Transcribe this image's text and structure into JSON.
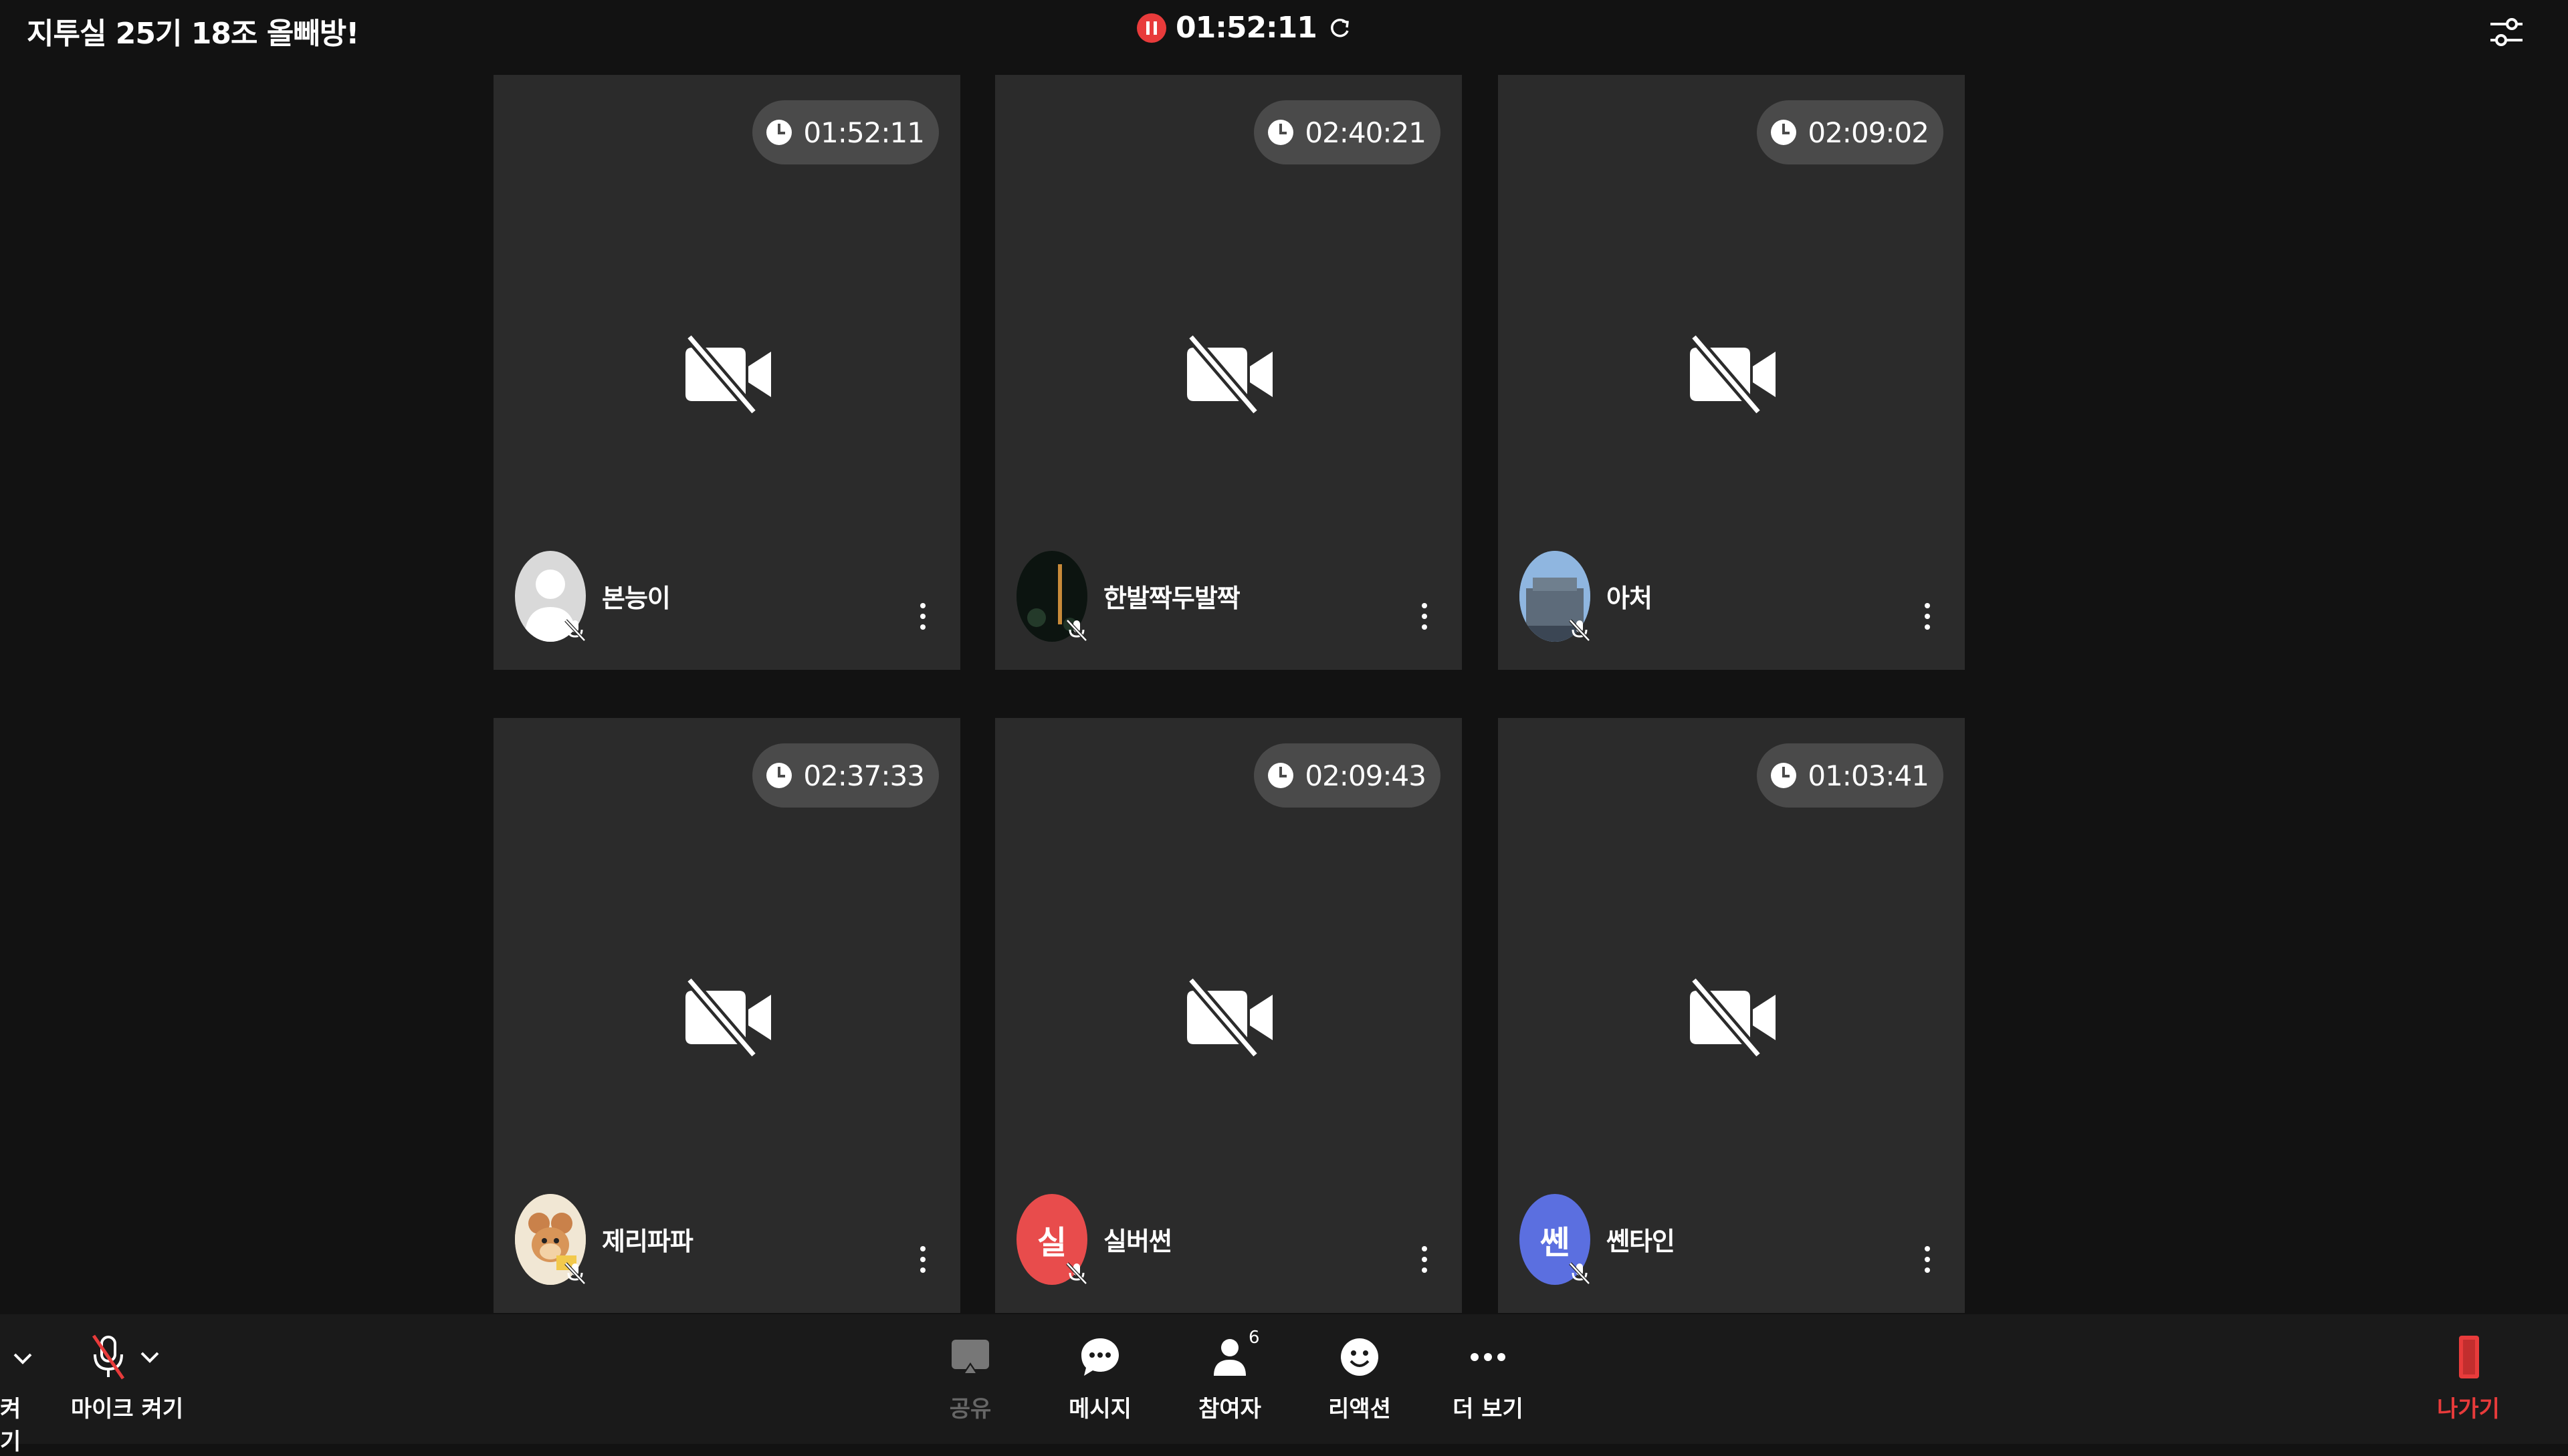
{
  "header": {
    "room_title": "지투실 25기 18조 올빼방!",
    "session_timer": "01:52:11",
    "colors": {
      "record": "#e83b3b",
      "tile_bg": "#2b2b2b",
      "pill_bg": "#4a4a4a"
    }
  },
  "participants": [
    {
      "name": "본능이",
      "timer": "01:52:11",
      "avatar_type": "default-person",
      "avatar_letter": "",
      "avatar_color": "#d9d9d9"
    },
    {
      "name": "한발짝두발짝",
      "timer": "02:40:21",
      "avatar_type": "night-photo",
      "avatar_letter": "",
      "avatar_color": "#1b2a20"
    },
    {
      "name": "아처",
      "timer": "02:09:02",
      "avatar_type": "building-photo",
      "avatar_letter": "",
      "avatar_color": "#7aa0c8"
    },
    {
      "name": "제리파파",
      "timer": "02:37:33",
      "avatar_type": "cartoon-mouse",
      "avatar_letter": "",
      "avatar_color": "#e9d7b5"
    },
    {
      "name": "실버썬",
      "timer": "02:09:43",
      "avatar_type": "letter",
      "avatar_letter": "실",
      "avatar_color": "#e84c4c"
    },
    {
      "name": "쎈타인",
      "timer": "01:03:41",
      "avatar_type": "letter",
      "avatar_letter": "쎈",
      "avatar_color": "#5b6fe0"
    }
  ],
  "toolbar": {
    "camera_label_partial": "켜기",
    "mic_label": "마이크 켜기",
    "share_label": "공유",
    "message_label": "메시지",
    "participants_label": "참여자",
    "participants_count": "6",
    "reaction_label": "리액션",
    "more_label": "더 보기",
    "leave_label": "나가기"
  }
}
